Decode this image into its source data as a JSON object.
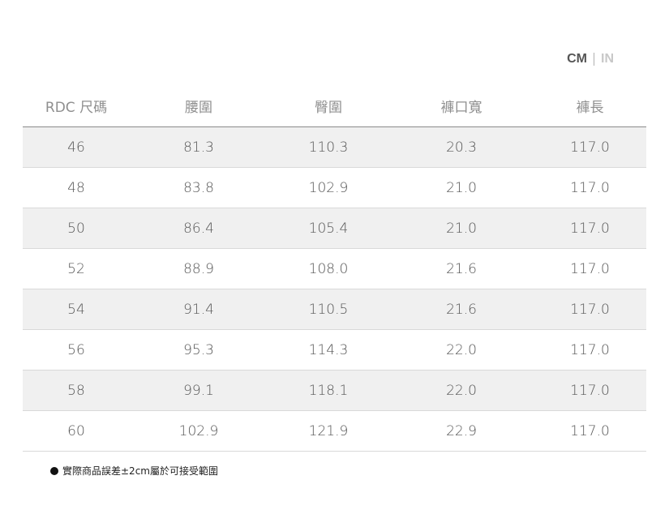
{
  "units": {
    "active": "CM",
    "inactive": "IN"
  },
  "table": {
    "headers": [
      "RDC 尺碼",
      "腰圍",
      "臀圍",
      "褲口寬",
      "褲長"
    ],
    "rows": [
      [
        "46",
        "81.3",
        "110.3",
        "20.3",
        "117.0"
      ],
      [
        "48",
        "83.8",
        "102.9",
        "21.0",
        "117.0"
      ],
      [
        "50",
        "86.4",
        "105.4",
        "21.0",
        "117.0"
      ],
      [
        "52",
        "88.9",
        "108.0",
        "21.6",
        "117.0"
      ],
      [
        "54",
        "91.4",
        "110.5",
        "21.6",
        "117.0"
      ],
      [
        "56",
        "95.3",
        "114.3",
        "22.0",
        "117.0"
      ],
      [
        "58",
        "99.1",
        "118.1",
        "22.0",
        "117.0"
      ],
      [
        "60",
        "102.9",
        "121.9",
        "22.9",
        "117.0"
      ]
    ]
  },
  "note": {
    "text": "實際商品誤差±2cm屬於可接受範圍"
  },
  "colors": {
    "shaded_row": "#f0f0f0",
    "text": "#555555",
    "header_text": "#8f8f8f",
    "inactive_unit": "#c8c8c8"
  }
}
